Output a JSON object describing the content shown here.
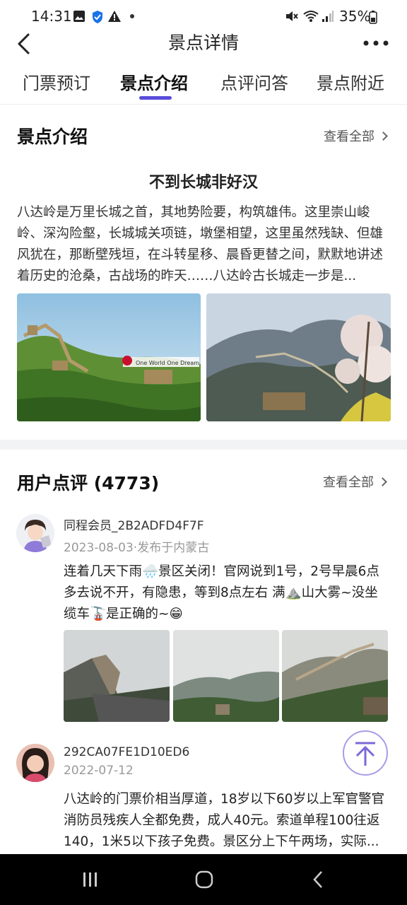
{
  "status_bar": {
    "time": "14:31",
    "battery": "35%"
  },
  "nav": {
    "title": "景点详情"
  },
  "tabs": [
    {
      "label": "门票预订"
    },
    {
      "label": "景点介绍"
    },
    {
      "label": "点评问答"
    },
    {
      "label": "景点附近"
    }
  ],
  "intro": {
    "section_title": "景点介绍",
    "view_all": "查看全部",
    "heading": "不到长城非好汉",
    "text": "八达岭是万里长城之首，其地势险要，构筑雄伟。这里崇山峻岭、深沟险壑，长城城关项链，墩堡相望，这里虽然残缺、但雄风犹在，那断壁残垣，在斗转星移、晨昏更替之间，默默地讲述着历史的沧桑，古战场的昨天……八达岭古长城走一步是...",
    "photo_sign_text": "One World One Dream"
  },
  "reviews": {
    "section_title": "用户点评 (4773)",
    "view_all": "查看全部",
    "items": [
      {
        "user": "同程会员_2B2ADFD4F7F",
        "meta": "2023-08-03·发布于内蒙古",
        "text_line1": "连着几天下雨🌧️景区关闭！官网说到1号，2号早晨6点",
        "text_line2": "多去说不开，有隐患，等到8点左右  满⛰️山大雾~没坐",
        "text_line3": "缆车🚡是正确的~😁"
      },
      {
        "user": "292CA07FE1D10ED6",
        "meta": "2022-07-12",
        "text_line1": "八达岭的门票价相当厚道，18岁以下60岁以上军官警官",
        "text_line2": "消防员残疾人全都免费，成人40元。索道单程100往返",
        "text_line3": "140，1米5以下孩子免费。景区分上下午两场，实际..."
      }
    ]
  },
  "colors": {
    "accent": "#5a4cdb",
    "divider": "#f2f3f5"
  }
}
